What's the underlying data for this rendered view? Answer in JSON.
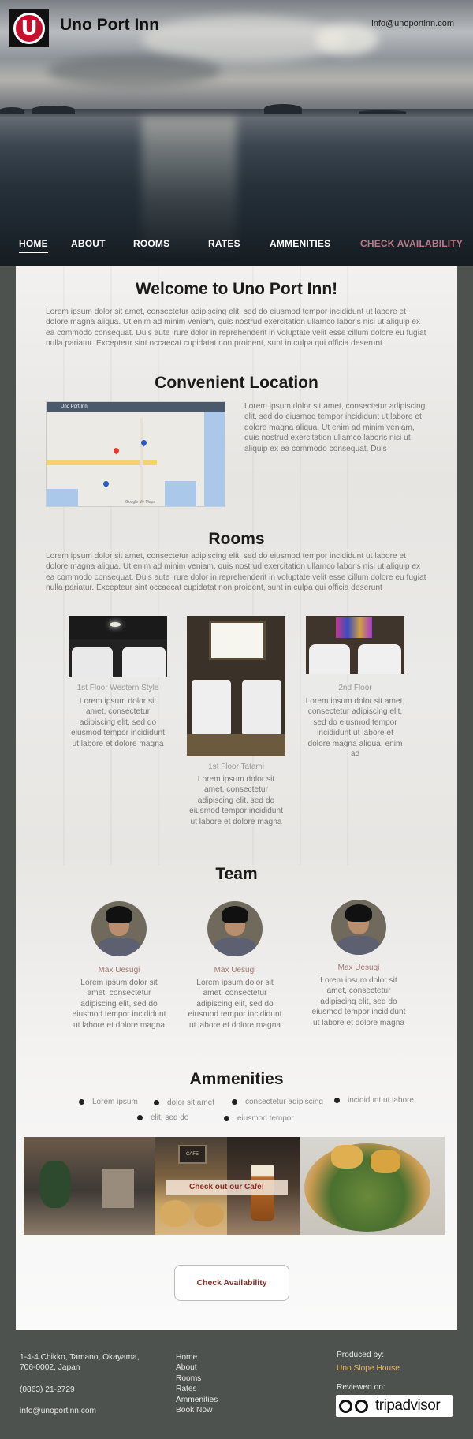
{
  "header": {
    "brand": "Uno Port Inn",
    "logo_letter": "U",
    "email": "info@unoportinn.com"
  },
  "nav": {
    "home": "HOME",
    "about": "ABOUT",
    "rooms": "ROOMS",
    "rates": "RATES",
    "amenities": "AMMENITIES",
    "check": "CHECK AVAILABILITY"
  },
  "welcome": {
    "title": "Welcome to Uno Port Inn!",
    "text": "Lorem ipsum dolor sit amet, consectetur adipiscing elit, sed do eiusmod tempor incididunt ut labore et dolore magna aliqua. Ut enim ad minim veniam, quis nostrud exercitation ullamco laboris nisi ut aliquip ex ea commodo consequat. Duis aute irure dolor in reprehenderit in voluptate velit esse cillum dolore eu fugiat nulla pariatur. Excepteur sint occaecat cupidatat non proident, sunt in culpa qui officia deserunt"
  },
  "location": {
    "title": "Convenient Location",
    "map_title": "Uno Port Inn",
    "map_footer": "Google My Maps",
    "text": "Lorem ipsum dolor sit amet, consectetur adipiscing elit, sed do eiusmod tempor incididunt ut labore et dolore magna aliqua. Ut enim ad minim veniam, quis nostrud exercitation ullamco laboris nisi ut aliquip ex ea commodo consequat. Duis"
  },
  "rooms": {
    "title": "Rooms",
    "text": "Lorem ipsum dolor sit amet, consectetur adipiscing elit, sed do eiusmod tempor incididunt ut labore et dolore magna aliqua. Ut enim ad minim veniam, quis nostrud exercitation ullamco laboris nisi ut aliquip ex ea commodo consequat. Duis aute irure dolor in reprehenderit in voluptate velit esse cillum dolore eu fugiat nulla pariatur. Excepteur sint occaecat cupidatat non proident, sunt in culpa qui officia deserunt",
    "items": [
      {
        "caption": "1st Floor Western Style",
        "desc": "Lorem ipsum dolor sit amet, consectetur adipiscing elit, sed do eiusmod tempor incididunt ut labore et dolore magna"
      },
      {
        "caption": "1st Floor Tatami",
        "desc": "Lorem ipsum dolor sit amet, consectetur adipiscing elit, sed do eiusmod tempor incididunt ut labore et dolore magna"
      },
      {
        "caption": "2nd Floor",
        "desc": "Lorem ipsum dolor sit amet, consectetur adipiscing elit, sed do eiusmod tempor incididunt ut labore et dolore magna aliqua. enim ad"
      }
    ]
  },
  "team": {
    "title": "Team",
    "members": [
      {
        "name": "Max Uesugi",
        "desc": "Lorem ipsum dolor sit amet, consectetur adipiscing elit, sed do eiusmod tempor incididunt ut labore et dolore magna"
      },
      {
        "name": "Max Uesugi",
        "desc": "Lorem ipsum dolor sit amet, consectetur adipiscing elit, sed do eiusmod tempor incididunt ut labore et dolore magna"
      },
      {
        "name": "Max Uesugi",
        "desc": "Lorem ipsum dolor sit amet, consectetur adipiscing elit, sed do eiusmod tempor incididunt ut labore et dolore magna"
      }
    ]
  },
  "amenities": {
    "title": "Ammenities",
    "items": [
      "Lorem ipsum",
      "dolor sit amet",
      "consectetur adipiscing",
      "incididunt ut labore",
      "elit, sed do",
      "eiusmod tempor"
    ],
    "cafe_label": "Check out our Cafe!",
    "cafe_sign": "CAFE"
  },
  "cta": {
    "label": "Check Availability"
  },
  "footer": {
    "address": "1-4-4 Chikko, Tamano, Okayama, 706-0002, Japan",
    "phone": "(0863) 21-2729",
    "email": "info@unoportinn.com",
    "links": [
      "Home",
      "About",
      "Rooms",
      "Rates",
      "Ammenities",
      "Book Now"
    ],
    "produced_label": "Produced by:",
    "produced_by": "Uno Slope House",
    "reviewed_label": "Reviewed on:",
    "review_site": "tripadvisor"
  }
}
